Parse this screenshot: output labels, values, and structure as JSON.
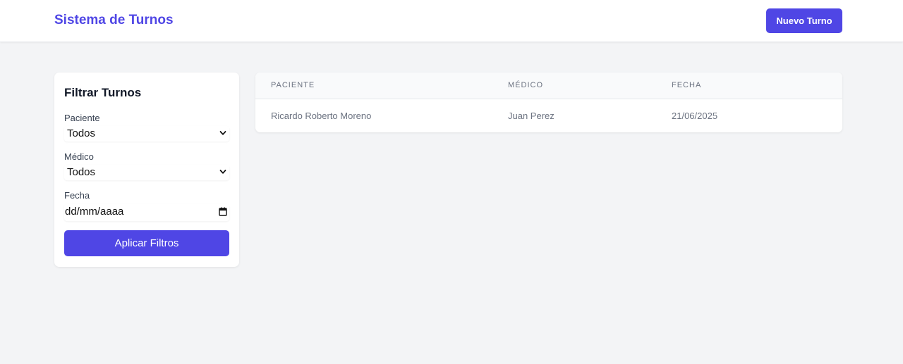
{
  "app": {
    "title": "Sistema de Turnos",
    "new_button_label": "Nuevo Turno"
  },
  "colors": {
    "accent": "#4f46e5",
    "page_background": "#f3f4f6",
    "card_background": "#ffffff"
  },
  "filters": {
    "title": "Filtrar Turnos",
    "patient": {
      "label": "Paciente",
      "selected": "Todos"
    },
    "doctor": {
      "label": "Médico",
      "selected": "Todos"
    },
    "date": {
      "label": "Fecha",
      "placeholder": "dd/mm/aaaa"
    },
    "apply_label": "Aplicar Filtros"
  },
  "table": {
    "columns": [
      "Paciente",
      "Médico",
      "Fecha"
    ],
    "rows": [
      {
        "patient": "Ricardo Roberto Moreno",
        "doctor": "Juan Perez",
        "date": "21/06/2025"
      }
    ]
  },
  "icons": {
    "select_chevron": "chevron-down-icon",
    "date_picker": "calendar-icon"
  }
}
